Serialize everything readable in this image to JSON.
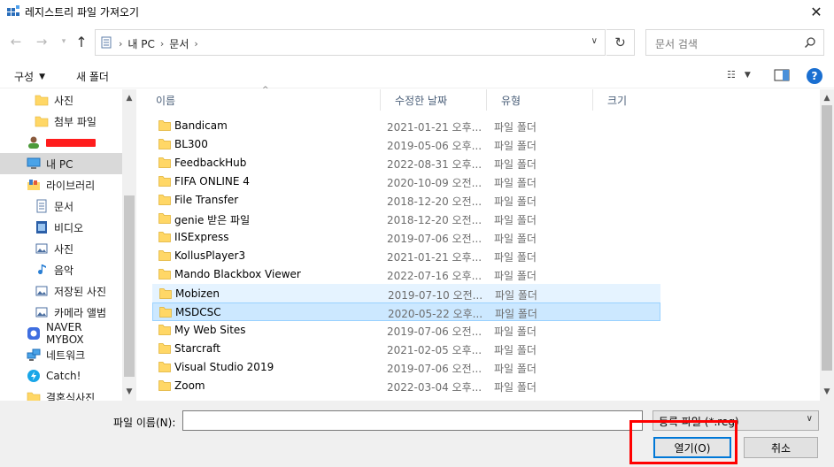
{
  "window": {
    "title": "레지스트리 파일 가져오기",
    "close": "✕"
  },
  "address": {
    "path": [
      "내 PC",
      "문서"
    ],
    "search_placeholder": "문서 검색"
  },
  "toolbar": {
    "organize_label": "구성",
    "new_folder_label": "새 폴더"
  },
  "nav": {
    "items": [
      {
        "label": "사진",
        "icon": "folder-icon",
        "indent": 1
      },
      {
        "label": "첨부 파일",
        "icon": "folder-icon",
        "indent": 1
      },
      {
        "label": "",
        "icon": "user-icon",
        "indent": 0,
        "redacted": true
      },
      {
        "label": "내 PC",
        "icon": "pc-icon",
        "indent": 0,
        "selected": true
      },
      {
        "label": "라이브러리",
        "icon": "library-icon",
        "indent": 0
      },
      {
        "label": "문서",
        "icon": "documents-icon",
        "indent": 1
      },
      {
        "label": "비디오",
        "icon": "video-icon",
        "indent": 1
      },
      {
        "label": "사진",
        "icon": "pictures-icon",
        "indent": 1
      },
      {
        "label": "음악",
        "icon": "music-icon",
        "indent": 1
      },
      {
        "label": "저장된 사진",
        "icon": "pictures-icon",
        "indent": 1
      },
      {
        "label": "카메라 앨범",
        "icon": "pictures-icon",
        "indent": 1
      },
      {
        "label": "NAVER MYBOX",
        "icon": "mybox-icon",
        "indent": 0
      },
      {
        "label": "네트워크",
        "icon": "network-icon",
        "indent": 0
      },
      {
        "label": "Catch!",
        "icon": "catch-icon",
        "indent": 0
      },
      {
        "label": "결혼식사진",
        "icon": "folder-icon",
        "indent": 0
      }
    ]
  },
  "columns": {
    "name": "이름",
    "date": "수정한 날짜",
    "type": "유형",
    "size": "크기"
  },
  "files": [
    {
      "name": "Bandicam",
      "date": "2021-01-21 오후...",
      "type": "파일 폴더"
    },
    {
      "name": "BL300",
      "date": "2019-05-06 오후...",
      "type": "파일 폴더"
    },
    {
      "name": "FeedbackHub",
      "date": "2022-08-31 오후...",
      "type": "파일 폴더"
    },
    {
      "name": "FIFA ONLINE 4",
      "date": "2020-10-09 오전...",
      "type": "파일 폴더"
    },
    {
      "name": "File Transfer",
      "date": "2018-12-20 오전...",
      "type": "파일 폴더"
    },
    {
      "name": "genie 받은 파일",
      "date": "2018-12-20 오전...",
      "type": "파일 폴더"
    },
    {
      "name": "IISExpress",
      "date": "2019-07-06 오전...",
      "type": "파일 폴더"
    },
    {
      "name": "KollusPlayer3",
      "date": "2021-01-21 오후...",
      "type": "파일 폴더"
    },
    {
      "name": "Mando Blackbox Viewer",
      "date": "2022-07-16 오후...",
      "type": "파일 폴더"
    },
    {
      "name": "Mobizen",
      "date": "2019-07-10 오전...",
      "type": "파일 폴더",
      "state": "hover"
    },
    {
      "name": "MSDCSC",
      "date": "2020-05-22 오후...",
      "type": "파일 폴더",
      "state": "selected"
    },
    {
      "name": "My Web Sites",
      "date": "2019-07-06 오전...",
      "type": "파일 폴더"
    },
    {
      "name": "Starcraft",
      "date": "2021-02-05 오후...",
      "type": "파일 폴더"
    },
    {
      "name": "Visual Studio 2019",
      "date": "2019-07-06 오전...",
      "type": "파일 폴더"
    },
    {
      "name": "Zoom",
      "date": "2022-03-04 오후...",
      "type": "파일 폴더"
    }
  ],
  "footer": {
    "filename_label": "파일 이름(N):",
    "filename_value": "",
    "filter_label": "등록 파일 (*.reg)",
    "open_label": "열기(O)",
    "cancel_label": "취소"
  },
  "colors": {
    "accent": "#0078d7",
    "selected_row": "#cce8ff",
    "hover_row": "#e5f3ff",
    "annotation": "#ff0000",
    "folder": "#ffd766"
  }
}
